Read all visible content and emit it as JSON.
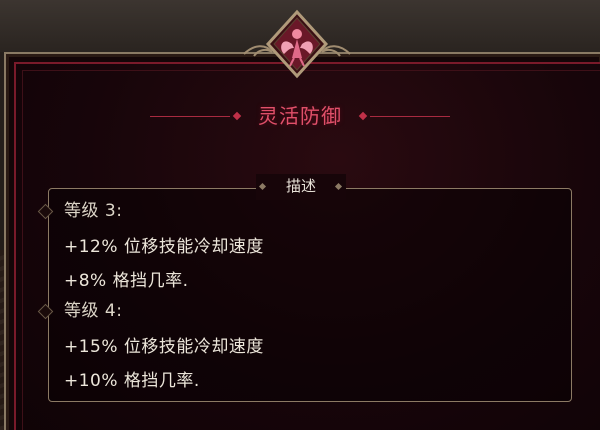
{
  "skill": {
    "title": "灵活防御",
    "emblem_icon": "winged-figure-emblem-icon"
  },
  "description": {
    "header": "描述",
    "levels": [
      {
        "heading": "等级 3:",
        "effects": [
          "+12% 位移技能冷却速度",
          "+8% 格挡几率."
        ]
      },
      {
        "heading": "等级 4:",
        "effects": [
          "+15% 位移技能冷却速度",
          "+10% 格挡几率."
        ]
      }
    ]
  },
  "colors": {
    "title": "#e0506a",
    "frame_gold": "#8c7a64",
    "frame_crimson": "#7a1a2a",
    "text": "#ece6da"
  }
}
